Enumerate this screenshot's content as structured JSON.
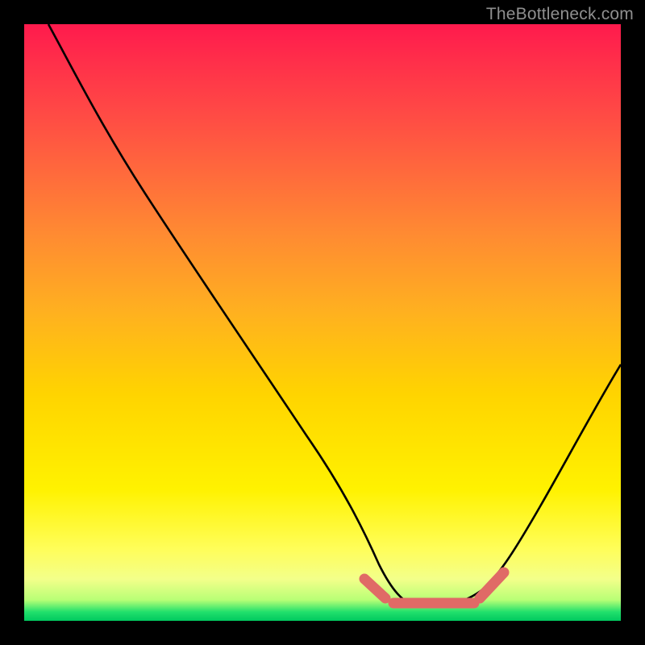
{
  "watermark": "TheBottleneck.com",
  "chart_data": {
    "type": "line",
    "title": "",
    "xlabel": "",
    "ylabel": "",
    "xlim": [
      0,
      100
    ],
    "ylim": [
      0,
      100
    ],
    "grid": false,
    "series": [
      {
        "name": "bottleneck-curve",
        "x": [
          4,
          10,
          20,
          30,
          40,
          50,
          55,
          58,
          60,
          63,
          67,
          72,
          77,
          80,
          85,
          90,
          97,
          100
        ],
        "y": [
          100,
          90,
          76,
          61,
          46,
          30,
          20,
          12,
          6,
          2,
          2,
          2,
          4,
          8,
          16,
          27,
          42,
          50
        ]
      }
    ],
    "annotations": [
      {
        "name": "valley-highlight",
        "color": "#e06a66",
        "segments_x": [
          [
            56,
            60
          ],
          [
            61,
            77
          ],
          [
            78,
            82
          ]
        ],
        "segments_y": [
          [
            14,
            5
          ],
          [
            3,
            4
          ],
          [
            7,
            12
          ]
        ]
      }
    ],
    "background_scale": {
      "type": "vertical-gradient",
      "stops": [
        {
          "pct": 0,
          "color": "#ff1a4d",
          "meaning": "high"
        },
        {
          "pct": 50,
          "color": "#ffc000",
          "meaning": "mid"
        },
        {
          "pct": 88,
          "color": "#fffe5a",
          "meaning": "low"
        },
        {
          "pct": 100,
          "color": "#00c95f",
          "meaning": "optimal"
        }
      ]
    }
  }
}
